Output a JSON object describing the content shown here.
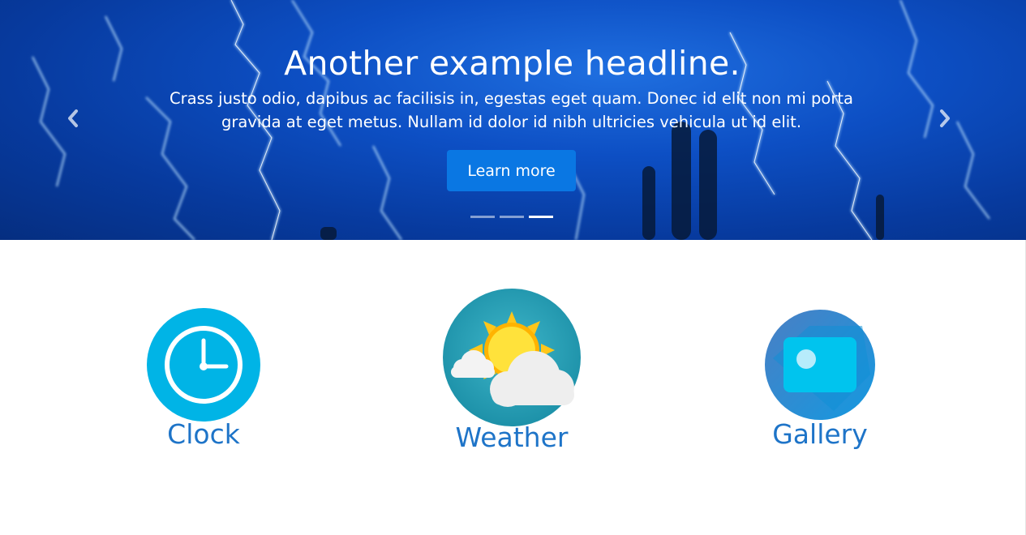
{
  "carousel": {
    "headline": "Another example headline.",
    "text_line1": "Crass justo odio, dapibus ac facilisis in, egestas eget quam. Donec id elit non mi porta",
    "text_line2": "gravida at eget metus. Nullam id dolor id nibh ultricies vehicula ut id elit.",
    "button_label": "Learn more",
    "slide_count": 3,
    "active_slide": 3,
    "prev_icon": "chevron-left-icon",
    "next_icon": "chevron-right-icon"
  },
  "features": [
    {
      "label": "Clock",
      "icon": "clock-icon"
    },
    {
      "label": "Weather",
      "icon": "weather-icon"
    },
    {
      "label": "Gallery",
      "icon": "gallery-icon"
    }
  ],
  "colors": {
    "accent": "#0a77e3",
    "label": "#1e74c8",
    "clock_bg": "#00b4e6",
    "gallery_bg": "#1f8fdc"
  }
}
